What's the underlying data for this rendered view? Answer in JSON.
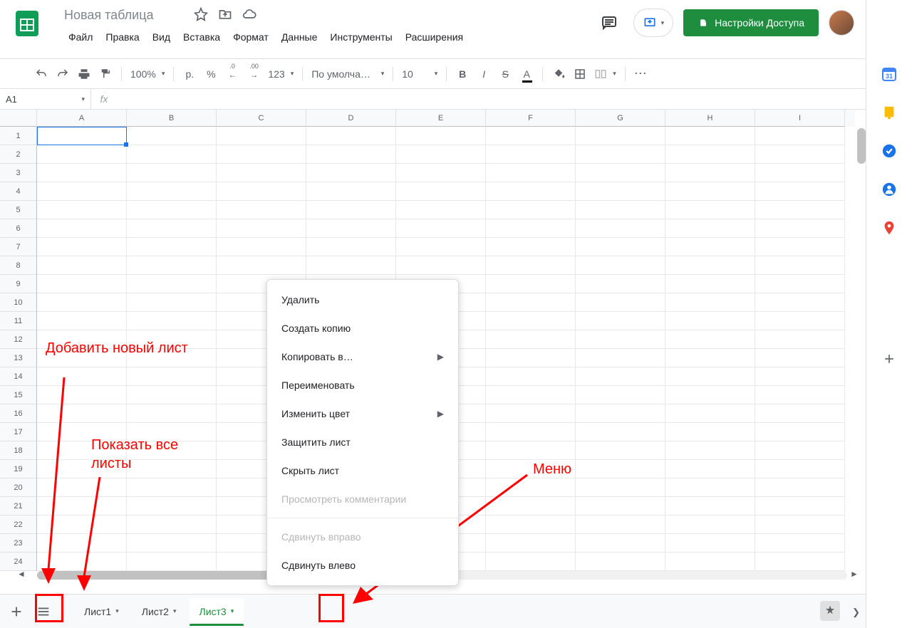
{
  "doc": {
    "title": "Новая таблица"
  },
  "menubar": [
    "Файл",
    "Правка",
    "Вид",
    "Вставка",
    "Формат",
    "Данные",
    "Инструменты",
    "Расширения"
  ],
  "share_label": "Настройки Доступа",
  "toolbar": {
    "zoom": "100%",
    "currency": "р.",
    "percent": "%",
    "dec_dec": ".0",
    "dec_inc": ".00",
    "num_fmt": "123",
    "font": "По умолча…",
    "font_size": "10",
    "more": "⋯",
    "collapse": "^"
  },
  "name_box": "A1",
  "fx": "fx",
  "columns": [
    "A",
    "B",
    "C",
    "D",
    "E",
    "F",
    "G",
    "H",
    "I"
  ],
  "rows": 24,
  "sheet_tabs": [
    {
      "label": "Лист1",
      "active": false
    },
    {
      "label": "Лист2",
      "active": false
    },
    {
      "label": "Лист3",
      "active": true
    }
  ],
  "context_menu": [
    {
      "label": "Удалить",
      "type": "item"
    },
    {
      "label": "Создать копию",
      "type": "item"
    },
    {
      "label": "Копировать в…",
      "type": "submenu"
    },
    {
      "label": "Переименовать",
      "type": "item"
    },
    {
      "label": "Изменить цвет",
      "type": "submenu"
    },
    {
      "label": "Защитить лист",
      "type": "item"
    },
    {
      "label": "Скрыть лист",
      "type": "item"
    },
    {
      "label": "Просмотреть комментарии",
      "type": "disabled"
    },
    {
      "type": "sep"
    },
    {
      "label": "Сдвинуть вправо",
      "type": "disabled"
    },
    {
      "label": "Сдвинуть влево",
      "type": "item"
    }
  ],
  "annotations": {
    "add_sheet": "Добавить новый лист",
    "all_sheets": "Показать все листы",
    "menu": "Меню"
  },
  "side_calendar_day": "31"
}
